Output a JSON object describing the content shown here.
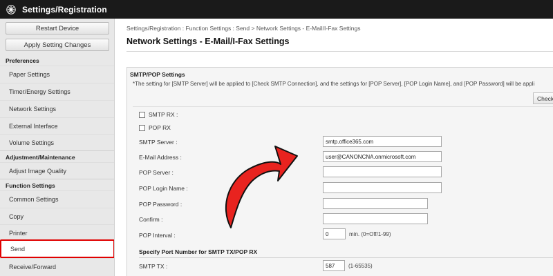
{
  "app": {
    "title": "Settings/Registration",
    "logo_icon": "asterisk-star-icon"
  },
  "sidebar": {
    "buttons": [
      {
        "label": "Restart Device"
      },
      {
        "label": "Apply Setting Changes"
      }
    ],
    "sections": [
      {
        "title": "Preferences",
        "items": [
          "Paper Settings",
          "Timer/Energy Settings",
          "Network Settings",
          "External Interface",
          "Volume Settings"
        ]
      },
      {
        "title": "Adjustment/Maintenance",
        "items": [
          "Adjust Image Quality"
        ]
      },
      {
        "title": "Function Settings",
        "items": [
          "Common Settings",
          "Copy",
          "Printer",
          "Send",
          "Receive/Forward"
        ]
      }
    ],
    "active_item": "Send",
    "highlight_color": "#e00000"
  },
  "main": {
    "breadcrumb": "Settings/Registration : Function Settings : Send > Network Settings - E-Mail/I-Fax Settings",
    "title": "Network Settings - E-Mail/I-Fax Settings",
    "panel": {
      "heading": "SMTP/POP Settings",
      "note": "*The setting for [SMTP Server] will be applied to [Check SMTP Connection], and the settings for [POP Server], [POP Login Name], and [POP Password] will be appli",
      "check_button": "Check",
      "checkboxes": [
        {
          "label": "SMTP RX :",
          "checked": false
        },
        {
          "label": "POP RX",
          "checked": false
        }
      ],
      "fields": [
        {
          "label": "SMTP Server :",
          "value": "smtp.office365.com"
        },
        {
          "label": "E-Mail Address :",
          "value": "user@CANONCNA.onmicrosoft.com"
        },
        {
          "label": "POP Server :",
          "value": ""
        },
        {
          "label": "POP Login Name :",
          "value": ""
        },
        {
          "label": "POP Password :",
          "value": ""
        },
        {
          "label": "Confirm :",
          "value": ""
        },
        {
          "label": "POP Interval :",
          "value": "0",
          "suffix": "min. (0=Off/1-99)"
        }
      ],
      "port_heading": "Specify Port Number for SMTP TX/POP RX",
      "port_fields": [
        {
          "label": "SMTP TX :",
          "value": "587",
          "suffix": "(1-65535)"
        }
      ]
    }
  },
  "annotation": {
    "arrow_color": "#e8231f",
    "arrow_icon": "curved-arrow-pointer-icon"
  }
}
